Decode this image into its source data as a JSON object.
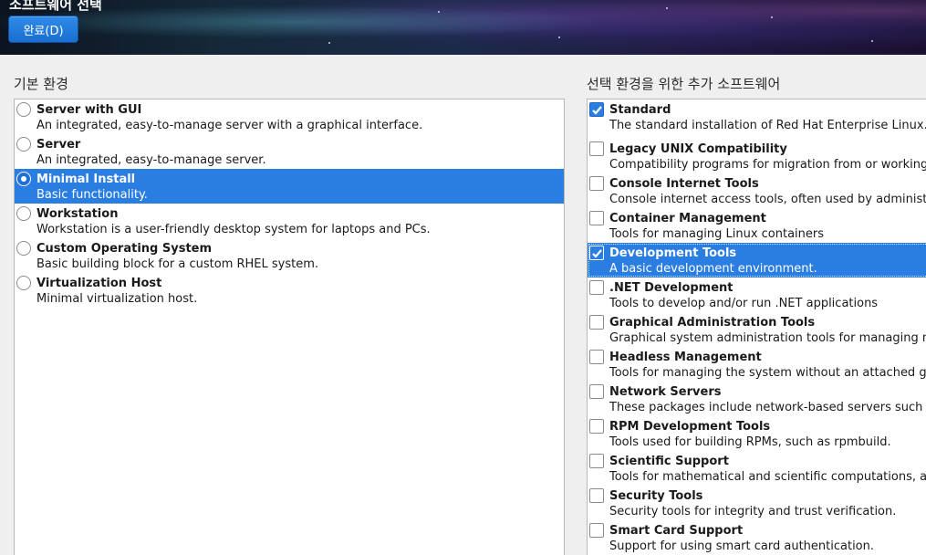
{
  "header": {
    "title": "소프트웨어 선택",
    "done_label": "완료(D)"
  },
  "base_environment": {
    "heading": "기본 환경",
    "items": [
      {
        "name": "Server with GUI",
        "desc": "An integrated, easy-to-manage server with a graphical interface.",
        "selected": false
      },
      {
        "name": "Server",
        "desc": "An integrated, easy-to-manage server.",
        "selected": false
      },
      {
        "name": "Minimal Install",
        "desc": "Basic functionality.",
        "selected": true
      },
      {
        "name": "Workstation",
        "desc": "Workstation is a user-friendly desktop system for laptops and PCs.",
        "selected": false
      },
      {
        "name": "Custom Operating System",
        "desc": "Basic building block for a custom RHEL system.",
        "selected": false
      },
      {
        "name": "Virtualization Host",
        "desc": "Minimal virtualization host.",
        "selected": false
      }
    ]
  },
  "addons": {
    "heading": "선택 환경을 위한 추가 소프트웨어",
    "items": [
      {
        "name": "Standard",
        "desc": "The standard installation of Red Hat Enterprise Linux.",
        "checked": true,
        "selected": false
      },
      {
        "name": "Legacy UNIX Compatibility",
        "desc": "Compatibility programs for migration from or working wit",
        "checked": false,
        "selected": false
      },
      {
        "name": "Console Internet Tools",
        "desc": "Console internet access tools, often used by administrator",
        "checked": false,
        "selected": false
      },
      {
        "name": "Container Management",
        "desc": "Tools for managing Linux containers",
        "checked": false,
        "selected": false
      },
      {
        "name": "Development Tools",
        "desc": "A basic development environment.",
        "checked": true,
        "selected": true
      },
      {
        "name": ".NET Development",
        "desc": "Tools to develop and/or run .NET applications",
        "checked": false,
        "selected": false
      },
      {
        "name": "Graphical Administration Tools",
        "desc": "Graphical system administration tools for managing many",
        "checked": false,
        "selected": false
      },
      {
        "name": "Headless Management",
        "desc": "Tools for managing the system without an attached graph",
        "checked": false,
        "selected": false
      },
      {
        "name": "Network Servers",
        "desc": "These packages include network-based servers such as DH",
        "checked": false,
        "selected": false
      },
      {
        "name": "RPM Development Tools",
        "desc": "Tools used for building RPMs, such as rpmbuild.",
        "checked": false,
        "selected": false
      },
      {
        "name": "Scientific Support",
        "desc": "Tools for mathematical and scientific computations, and p",
        "checked": false,
        "selected": false
      },
      {
        "name": "Security Tools",
        "desc": "Security tools for integrity and trust verification.",
        "checked": false,
        "selected": false
      },
      {
        "name": "Smart Card Support",
        "desc": "Support for using smart card authentication.",
        "checked": false,
        "selected": false
      }
    ]
  }
}
